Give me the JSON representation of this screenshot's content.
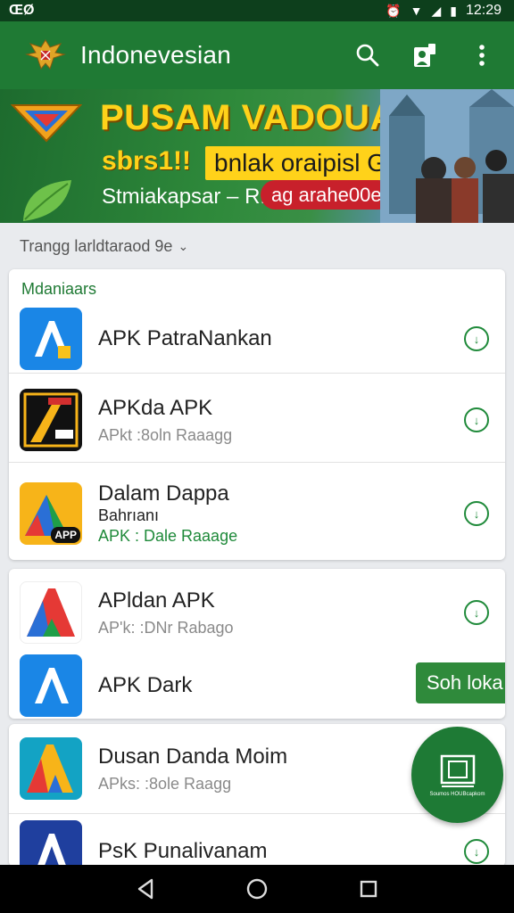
{
  "status_bar": {
    "left_text": "ŒØ",
    "time": "12:29"
  },
  "app_bar": {
    "title": "Indonevesian"
  },
  "banner": {
    "headline": "PUSAM VADOUAN",
    "promo_left": "sbrs1!!",
    "promo_tag": "bnlak oraipisl Grdne",
    "subtitle": "Stmiakapsar – Rı",
    "pill": "ag arahe00e"
  },
  "sort": {
    "label": "Trangg larldtaraod 9e"
  },
  "section": {
    "label": "Mdaniaars"
  },
  "apps": [
    {
      "name": "APK PatraNankan",
      "sub": "",
      "sub2": "",
      "icon_text": "A",
      "icon_color": "#1a86e6"
    },
    {
      "name": "APKda APK",
      "sub": "APkt :8oln Raaagg",
      "sub2": "",
      "icon_text": "",
      "icon_color": "#111111"
    },
    {
      "name": "Dalam Dappa",
      "sub2": "Bahrıanı",
      "sub": "APK : Dale Raaage",
      "icon_text": "APP",
      "icon_color": "#f7b419"
    },
    {
      "name": "APldan APK",
      "sub": "AP'k: :DNr Rabago",
      "sub2": "",
      "icon_text": "A",
      "icon_color": "#e53935"
    },
    {
      "name": "APK Dark",
      "sub": "",
      "sub2": "",
      "icon_text": "A",
      "icon_color": "#1a86e6"
    },
    {
      "name": "Dusan Danda Moim",
      "sub": "APks: :8ole Raagg",
      "sub2": "",
      "icon_text": "A",
      "icon_color": "#13a3c4"
    },
    {
      "name": "PsK Punalivanam",
      "sub": "",
      "sub2": "",
      "icon_text": "A",
      "icon_color": "#1f3f9e"
    }
  ],
  "snackbar": {
    "label": "Soh loka"
  },
  "fab": {
    "label": "Soumos HOUBcapkom"
  },
  "colors": {
    "primary": "#1f7a34",
    "status_bar": "#0d3f1c",
    "accent": "#1f8a3a"
  }
}
